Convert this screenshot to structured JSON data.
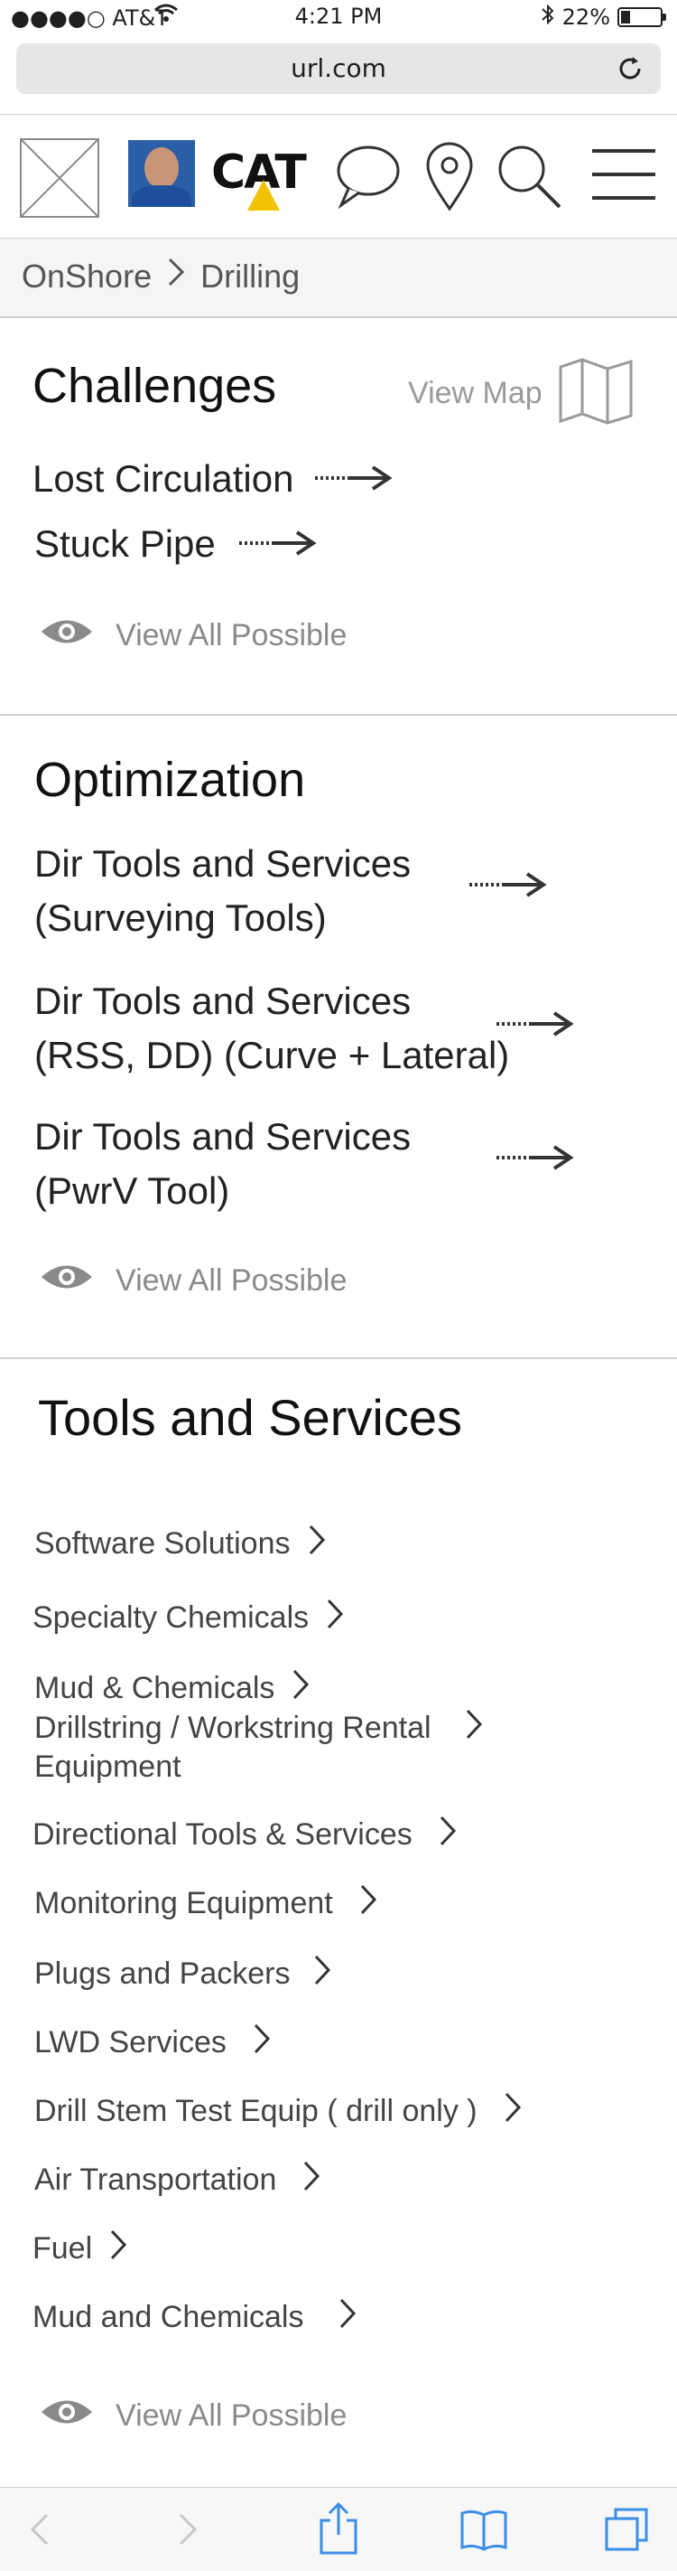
{
  "status_bar": {
    "carrier": "●●●●○ AT&T",
    "time": "4:21 PM",
    "battery": "22%",
    "battery_level": 0.22
  },
  "browser": {
    "url": "url.com"
  },
  "header": {
    "icons": [
      "logo-placeholder-icon",
      "avatar",
      "cat-logo",
      "chat-icon",
      "location-pin-icon",
      "search-icon",
      "menu-icon"
    ],
    "brand_text": "CAT"
  },
  "breadcrumb": {
    "items": [
      "OnShore",
      "Drilling"
    ]
  },
  "challenges": {
    "title": "Challenges",
    "view_map": "View Map",
    "items": [
      "Lost Circulation",
      "Stuck Pipe"
    ],
    "view_all": "View All Possible"
  },
  "optimization": {
    "title": "Optimization",
    "items": [
      {
        "line1": "Dir Tools and Services",
        "line2": "(Surveying Tools)"
      },
      {
        "line1": "Dir Tools and Services",
        "line2": "(RSS, DD) (Curve + Lateral)"
      },
      {
        "line1": "Dir Tools and Services",
        "line2": "(PwrV Tool)"
      }
    ],
    "view_all": "View All Possible"
  },
  "tools_services": {
    "title": "Tools and Services",
    "items": [
      "Software Solutions",
      "Specialty Chemicals",
      "Mud & Chemicals",
      "Drillstring / Workstring Rental",
      "Equipment",
      "Directional Tools & Services",
      "Monitoring Equipment",
      "Plugs and Packers",
      "LWD Services",
      "Drill Stem Test Equip ( drill only )",
      "Air Transportation",
      "Fuel",
      "Mud and Chemicals"
    ],
    "view_all": "View All Possible"
  },
  "colors": {
    "text": "#1f1f1f",
    "muted": "#8a8a8a",
    "divider": "#d2d2d2",
    "ios_blue": "#3a8ee6"
  }
}
